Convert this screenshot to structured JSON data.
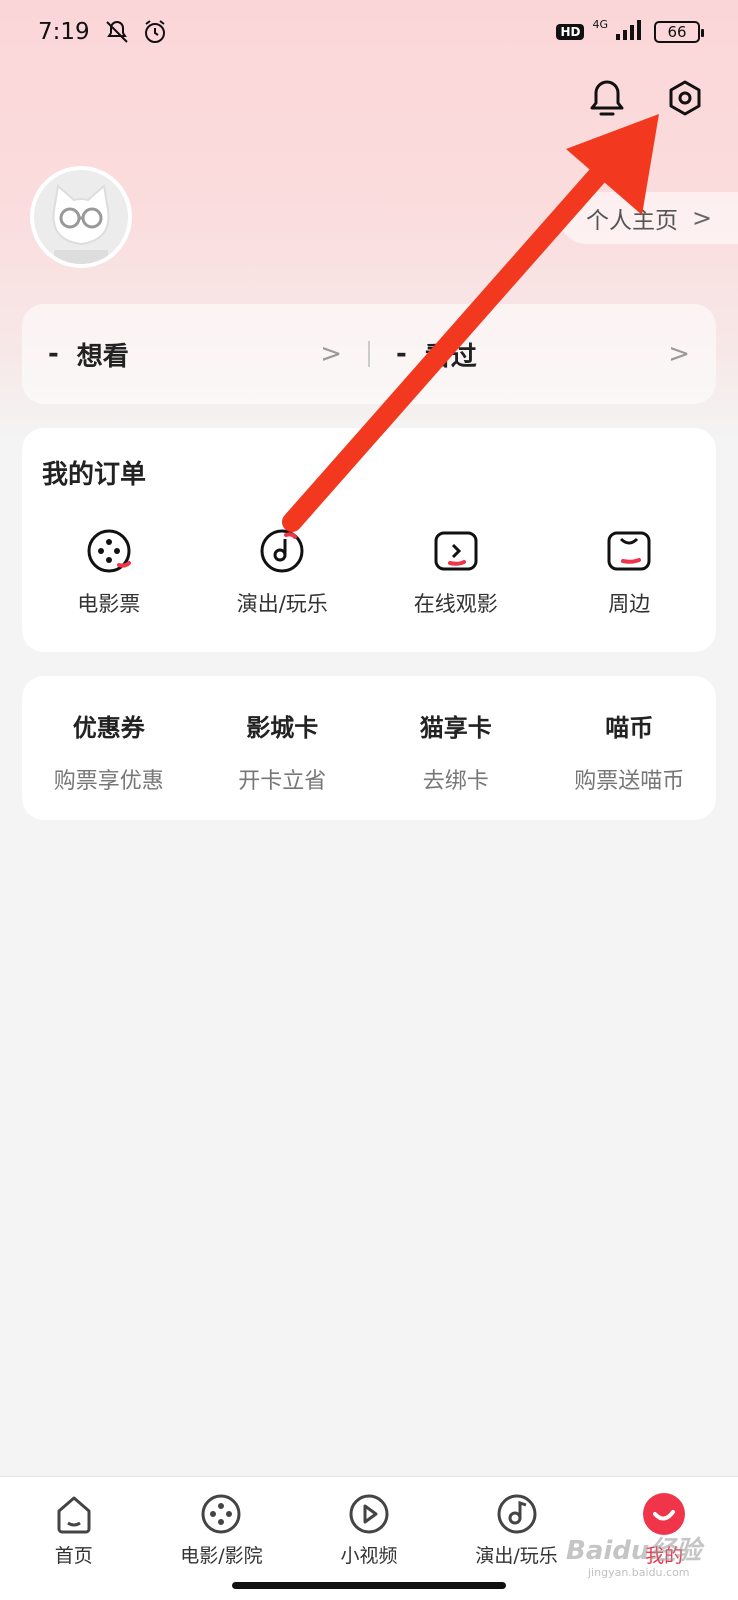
{
  "status_bar": {
    "time": "7:19",
    "hd": "HD",
    "network": "4G",
    "battery": "66"
  },
  "header": {
    "bell_icon": "bell-icon",
    "settings_icon": "settings-gear-icon",
    "profile_link": "个人主页",
    "chevron": ">"
  },
  "watch": {
    "want_count": "-",
    "want_label": "想看",
    "seen_count": "-",
    "seen_label": "看过",
    "chevron": ">"
  },
  "orders": {
    "title": "我的订单",
    "items": [
      {
        "label": "电影票",
        "icon": "film-reel-icon"
      },
      {
        "label": "演出/玩乐",
        "icon": "music-disc-icon"
      },
      {
        "label": "在线观影",
        "icon": "play-screen-icon"
      },
      {
        "label": "周边",
        "icon": "bag-icon"
      }
    ]
  },
  "benefits": [
    {
      "title": "优惠券",
      "subtitle": "购票享优惠"
    },
    {
      "title": "影城卡",
      "subtitle": "开卡立省"
    },
    {
      "title": "猫享卡",
      "subtitle": "去绑卡"
    },
    {
      "title": "喵币",
      "subtitle": "购票送喵币"
    }
  ],
  "tabbar": [
    {
      "label": "首页",
      "icon": "home-icon"
    },
    {
      "label": "电影/影院",
      "icon": "film-reel-icon"
    },
    {
      "label": "小视频",
      "icon": "play-circle-icon"
    },
    {
      "label": "演出/玩乐",
      "icon": "music-disc-icon"
    },
    {
      "label": "我的",
      "icon": "profile-smile-icon"
    }
  ],
  "watermark": {
    "text": "Baidu经验",
    "sub": "jingyan.baidu.com"
  },
  "colors": {
    "accent": "#f0354b",
    "arrow": "#f2391f"
  }
}
